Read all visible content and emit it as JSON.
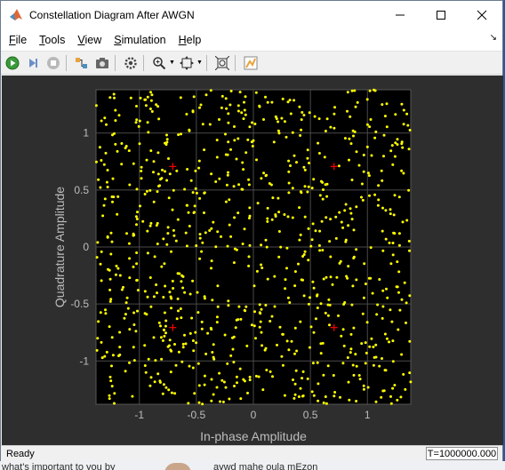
{
  "window": {
    "title": "Constellation Diagram After AWGN",
    "controls": {
      "minimize": "minimize",
      "maximize": "maximize",
      "close": "close"
    }
  },
  "menu": [
    "File",
    "Tools",
    "View",
    "Simulation",
    "Help"
  ],
  "toolbar": [
    "run-icon",
    "step-forward-icon",
    "stop-icon",
    "signal-selector-icon",
    "snapshot-icon",
    "settings-icon",
    "zoom-in-icon",
    "autoscale-icon",
    "fit-icon",
    "style-icon"
  ],
  "status": {
    "text": "Ready",
    "time": "T=1000000.000"
  },
  "background_text": {
    "left": "what's important to you by",
    "right": "aywd mahe oula mEzon"
  },
  "chart_data": {
    "type": "scatter",
    "xlabel": "In-phase Amplitude",
    "ylabel": "Quadrature Amplitude",
    "xlim": [
      -1.38,
      1.38
    ],
    "ylim": [
      -1.38,
      1.38
    ],
    "xticks": [
      "-1",
      "-0.5",
      "0",
      "0.5",
      "1"
    ],
    "yticks": [
      "1",
      "0.5",
      "0",
      "-0.5",
      "-1"
    ],
    "grid": true,
    "reference_points": [
      [
        -0.707,
        0.707
      ],
      [
        0.707,
        0.707
      ],
      [
        -0.707,
        -0.707
      ],
      [
        0.707,
        -0.707
      ]
    ],
    "received_points": {
      "count": 900,
      "distribution": "uniform",
      "colors": {
        "points": "#ffff00",
        "reference": "#ff0000",
        "axes_bg": "#000000",
        "figure_bg": "#2e2e2e",
        "grid": "#4a4a4a",
        "text": "#bdbdbd"
      }
    }
  }
}
